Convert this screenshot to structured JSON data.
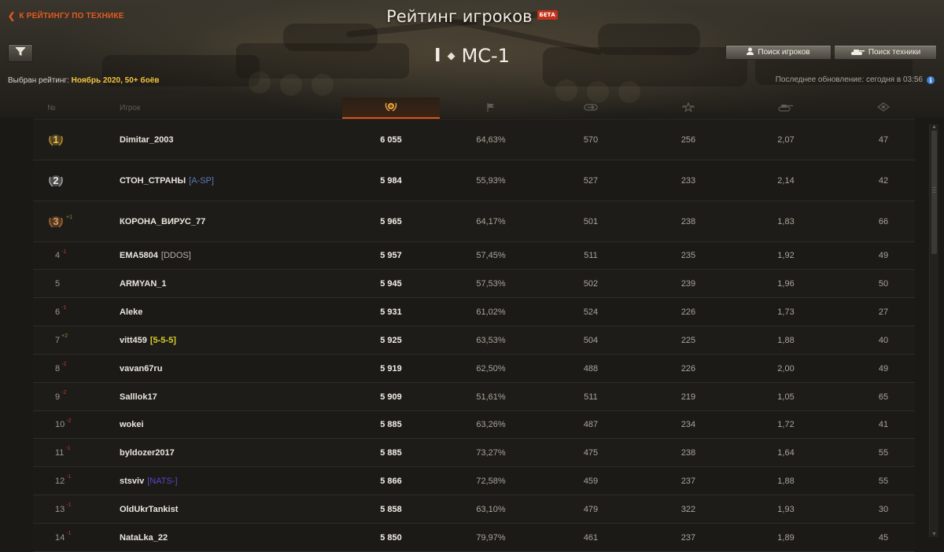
{
  "nav": {
    "back_label": "К РЕЙТИНГУ ПО ТЕХНИКЕ"
  },
  "header": {
    "title": "Рейтинг игроков",
    "beta": "БЕТА"
  },
  "vehicle": {
    "tier": "I",
    "name": "МС-1"
  },
  "buttons": {
    "search_players": "Поиск игроков",
    "search_tech": "Поиск техники"
  },
  "rating": {
    "label": "Выбран рейтинг:",
    "value": "Ноябрь 2020, 50+ боёв"
  },
  "update": {
    "text": "Последнее обновление: сегодня в 03:56"
  },
  "columns": {
    "rank": "№",
    "player": "Игрок",
    "icons": [
      "rating-laurel-icon",
      "win-flag-icon",
      "damage-icon",
      "xp-star-icon",
      "kills-tank-icon",
      "spotting-icon"
    ]
  },
  "colors": {
    "accent": "#d8541b",
    "gold": "#f4c53d",
    "up": "#6aa040",
    "down": "#c23a2a"
  },
  "rows": [
    {
      "rank": "1",
      "medal": "gold",
      "delta": "",
      "dir": "",
      "name": "Dimitar_2003",
      "clan": "",
      "clan_color": "",
      "score": "6 055",
      "winrate": "64,63%",
      "damage": "570",
      "xp": "256",
      "kills": "2,07",
      "spot": "47"
    },
    {
      "rank": "2",
      "medal": "silver",
      "delta": "",
      "dir": "",
      "name": "СТОН_СТРАНЫ",
      "clan": "[A-SP]",
      "clan_color": "#5b7bb5",
      "score": "5 984",
      "winrate": "55,93%",
      "damage": "527",
      "xp": "233",
      "kills": "2,14",
      "spot": "42"
    },
    {
      "rank": "3",
      "medal": "bronze",
      "delta": "+1",
      "dir": "up",
      "name": "КОРОНА_ВИРУС_77",
      "clan": "",
      "clan_color": "",
      "score": "5 965",
      "winrate": "64,17%",
      "damage": "501",
      "xp": "238",
      "kills": "1,83",
      "spot": "66"
    },
    {
      "rank": "4",
      "medal": "",
      "delta": "-1",
      "dir": "down",
      "name": "EMA5804",
      "clan": "[DDOS]",
      "clan_color": "#b5b0a5",
      "score": "5 957",
      "winrate": "57,45%",
      "damage": "511",
      "xp": "235",
      "kills": "1,92",
      "spot": "49"
    },
    {
      "rank": "5",
      "medal": "",
      "delta": "",
      "dir": "",
      "name": "ARMYAN_1",
      "clan": "",
      "clan_color": "",
      "score": "5 945",
      "winrate": "57,53%",
      "damage": "502",
      "xp": "239",
      "kills": "1,96",
      "spot": "50"
    },
    {
      "rank": "6",
      "medal": "",
      "delta": "-1",
      "dir": "down",
      "name": "Aleke",
      "clan": "",
      "clan_color": "",
      "score": "5 931",
      "winrate": "61,02%",
      "damage": "524",
      "xp": "226",
      "kills": "1,73",
      "spot": "27"
    },
    {
      "rank": "7",
      "medal": "",
      "delta": "+2",
      "dir": "up",
      "name": "vitt459",
      "clan": "[5-5-5]",
      "clan_color": "#d6cf2e",
      "score": "5 925",
      "winrate": "63,53%",
      "damage": "504",
      "xp": "225",
      "kills": "1,88",
      "spot": "40"
    },
    {
      "rank": "8",
      "medal": "",
      "delta": "-2",
      "dir": "down",
      "name": "vavan67ru",
      "clan": "",
      "clan_color": "",
      "score": "5 919",
      "winrate": "62,50%",
      "damage": "488",
      "xp": "226",
      "kills": "2,00",
      "spot": "49"
    },
    {
      "rank": "9",
      "medal": "",
      "delta": "-2",
      "dir": "down",
      "name": "Salllok17",
      "clan": "",
      "clan_color": "",
      "score": "5 909",
      "winrate": "51,61%",
      "damage": "511",
      "xp": "219",
      "kills": "1,05",
      "spot": "65"
    },
    {
      "rank": "10",
      "medal": "",
      "delta": "-2",
      "dir": "down",
      "name": "wokei",
      "clan": "",
      "clan_color": "",
      "score": "5 885",
      "winrate": "63,26%",
      "damage": "487",
      "xp": "234",
      "kills": "1,72",
      "spot": "41"
    },
    {
      "rank": "11",
      "medal": "",
      "delta": "-1",
      "dir": "down",
      "name": "byldozer2017",
      "clan": "",
      "clan_color": "",
      "score": "5 885",
      "winrate": "73,27%",
      "damage": "475",
      "xp": "238",
      "kills": "1,64",
      "spot": "55"
    },
    {
      "rank": "12",
      "medal": "",
      "delta": "-1",
      "dir": "down",
      "name": "stsviv",
      "clan": "[NATS-]",
      "clan_color": "#5a46c4",
      "score": "5 866",
      "winrate": "72,58%",
      "damage": "459",
      "xp": "237",
      "kills": "1,88",
      "spot": "55"
    },
    {
      "rank": "13",
      "medal": "",
      "delta": "-1",
      "dir": "down",
      "name": "OldUkrTankist",
      "clan": "",
      "clan_color": "",
      "score": "5 858",
      "winrate": "63,10%",
      "damage": "479",
      "xp": "322",
      "kills": "1,93",
      "spot": "30"
    },
    {
      "rank": "14",
      "medal": "",
      "delta": "-1",
      "dir": "down",
      "name": "NataLka_22",
      "clan": "",
      "clan_color": "",
      "score": "5 850",
      "winrate": "79,97%",
      "damage": "461",
      "xp": "237",
      "kills": "1,89",
      "spot": "45"
    }
  ]
}
